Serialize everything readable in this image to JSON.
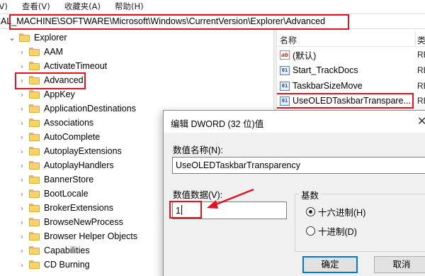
{
  "menu": {
    "items": [
      "(V)",
      "查看(V)",
      "收藏夹(A)",
      "帮助(H)"
    ]
  },
  "address": {
    "path": "CAL_MACHINE\\SOFTWARE\\Microsoft\\Windows\\CurrentVersion\\Explorer\\Advanced"
  },
  "tree": {
    "root": "Explorer",
    "items": [
      {
        "label": "AAM"
      },
      {
        "label": "ActivateTimeout"
      },
      {
        "label": "Advanced"
      },
      {
        "label": "AppKey"
      },
      {
        "label": "ApplicationDestinations"
      },
      {
        "label": "Associations"
      },
      {
        "label": "AutoComplete"
      },
      {
        "label": "AutoplayExtensions"
      },
      {
        "label": "AutoplayHandlers"
      },
      {
        "label": "BannerStore"
      },
      {
        "label": "BootLocale"
      },
      {
        "label": "BrokerExtensions"
      },
      {
        "label": "BrowseNewProcess"
      },
      {
        "label": "Browser Helper Objects"
      },
      {
        "label": "Capabilities"
      },
      {
        "label": "CD Burning"
      }
    ]
  },
  "list": {
    "name_header": "名称",
    "type_header": "类",
    "rows": [
      {
        "name": "(默认)",
        "type": "RE",
        "icon": "string-value-icon"
      },
      {
        "name": "Start_TrackDocs",
        "type": "RE",
        "icon": "dword-value-icon"
      },
      {
        "name": "TaskbarSizeMove",
        "type": "RE",
        "icon": "dword-value-icon"
      },
      {
        "name": "UseOLEDTaskbarTranspare...",
        "type": "RE",
        "icon": "dword-value-icon"
      }
    ]
  },
  "dialog": {
    "title": "编辑 DWORD (32 位)值",
    "name_label": "数值名称(N):",
    "name_value": "UseOLEDTaskbarTransparency",
    "data_label": "数值数据(V):",
    "data_value": "1",
    "base_label": "基数",
    "hex_label": "十六进制(H)",
    "dec_label": "十进制(D)",
    "selected_base": "hex",
    "ok_label": "确定",
    "cancel_label": "取消"
  },
  "colors": {
    "highlight": "#e0141e",
    "folder": "#f7d36e",
    "dialog_bg": "#f0f0f0"
  }
}
